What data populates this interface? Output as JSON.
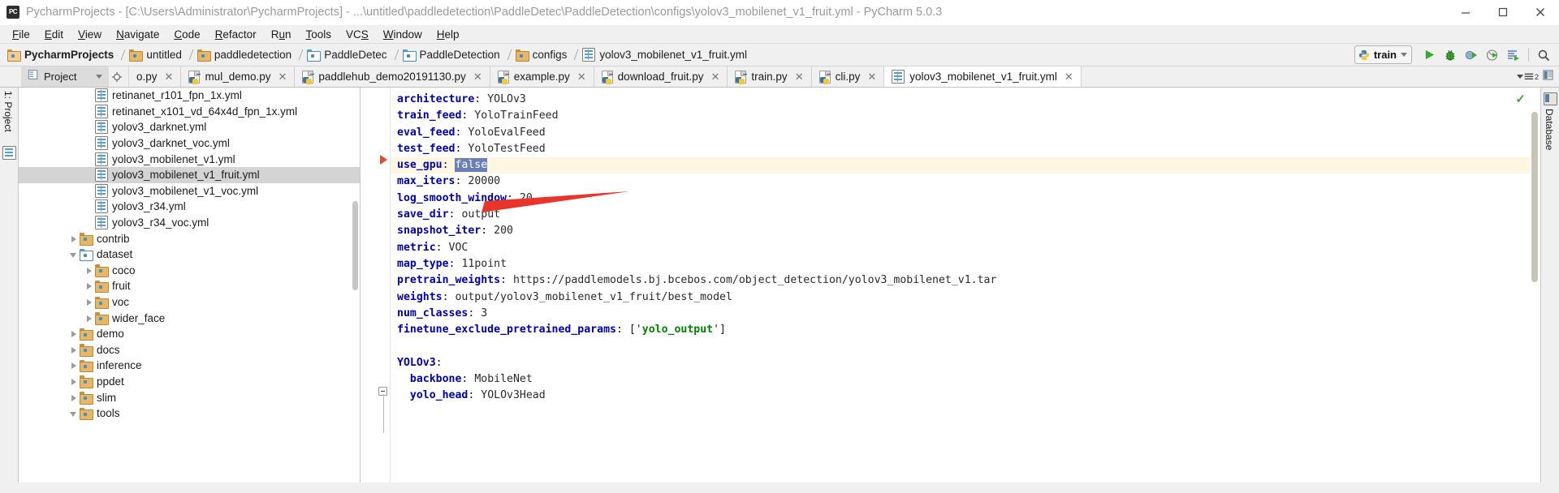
{
  "window": {
    "title": "PycharmProjects - [C:\\Users\\Administrator\\PycharmProjects] - ...\\untitled\\paddledetection\\PaddleDetec\\PaddleDetection\\configs\\yolov3_mobilenet_v1_fruit.yml - PyCharm 5.0.3",
    "app_icon": "pycharm-icon",
    "minimize": "—",
    "maximize": "❑",
    "close": "✕"
  },
  "menu": {
    "items": [
      {
        "label": "File",
        "mnemonic": "F"
      },
      {
        "label": "Edit",
        "mnemonic": "E"
      },
      {
        "label": "View",
        "mnemonic": "V"
      },
      {
        "label": "Navigate",
        "mnemonic": "N"
      },
      {
        "label": "Code",
        "mnemonic": "C"
      },
      {
        "label": "Refactor",
        "mnemonic": "R"
      },
      {
        "label": "Run",
        "mnemonic": "u"
      },
      {
        "label": "Tools",
        "mnemonic": "T"
      },
      {
        "label": "VCS",
        "mnemonic": "S"
      },
      {
        "label": "Window",
        "mnemonic": "W"
      },
      {
        "label": "Help",
        "mnemonic": "H"
      }
    ]
  },
  "breadcrumb": {
    "items": [
      {
        "label": "PycharmProjects",
        "icon": "folder-icon",
        "kind": "folder-open"
      },
      {
        "label": "untitled",
        "icon": "folder-icon",
        "kind": "folder"
      },
      {
        "label": "paddledetection",
        "icon": "folder-icon",
        "kind": "folder"
      },
      {
        "label": "PaddleDetec",
        "icon": "folder-icon",
        "kind": "folder-blue"
      },
      {
        "label": "PaddleDetection",
        "icon": "folder-icon",
        "kind": "folder-blue"
      },
      {
        "label": "configs",
        "icon": "folder-icon",
        "kind": "folder"
      },
      {
        "label": "yolov3_mobilenet_v1_fruit.yml",
        "icon": "yaml-file-icon",
        "kind": "yml"
      }
    ]
  },
  "toolbar": {
    "run_config": "train",
    "run_config_icon": "python-icon",
    "buttons": [
      {
        "name": "run-button",
        "icon": "play-icon"
      },
      {
        "name": "debug-button",
        "icon": "bug-icon"
      },
      {
        "name": "coverage-button",
        "icon": "coverage-icon"
      },
      {
        "name": "profile-button",
        "icon": "profile-icon"
      },
      {
        "name": "run-with-console-button",
        "icon": "console-run-icon"
      },
      {
        "name": "search-everywhere-button",
        "icon": "search-icon"
      }
    ]
  },
  "project_panel": {
    "title": "Project",
    "dropdown_icon": "chevron-down-icon",
    "tool_icons": [
      "locate-icon",
      "collapse-all-icon",
      "settings-icon",
      "hide-icon"
    ],
    "vertical_label": "1: Project",
    "tree": [
      {
        "label": "retinanet_r101_fpn_1x.yml",
        "indent": 4,
        "type": "yml",
        "arrow": "none"
      },
      {
        "label": "retinanet_x101_vd_64x4d_fpn_1x.yml",
        "indent": 4,
        "type": "yml",
        "arrow": "none"
      },
      {
        "label": "yolov3_darknet.yml",
        "indent": 4,
        "type": "yml",
        "arrow": "none"
      },
      {
        "label": "yolov3_darknet_voc.yml",
        "indent": 4,
        "type": "yml",
        "arrow": "none"
      },
      {
        "label": "yolov3_mobilenet_v1.yml",
        "indent": 4,
        "type": "yml",
        "arrow": "none"
      },
      {
        "label": "yolov3_mobilenet_v1_fruit.yml",
        "indent": 4,
        "type": "yml",
        "arrow": "none",
        "selected": true
      },
      {
        "label": "yolov3_mobilenet_v1_voc.yml",
        "indent": 4,
        "type": "yml",
        "arrow": "none"
      },
      {
        "label": "yolov3_r34.yml",
        "indent": 4,
        "type": "yml",
        "arrow": "none"
      },
      {
        "label": "yolov3_r34_voc.yml",
        "indent": 4,
        "type": "yml",
        "arrow": "none"
      },
      {
        "label": "contrib",
        "indent": 3,
        "type": "folder",
        "arrow": "right"
      },
      {
        "label": "dataset",
        "indent": 3,
        "type": "folder-blue",
        "arrow": "down"
      },
      {
        "label": "coco",
        "indent": 4,
        "type": "folder",
        "arrow": "right"
      },
      {
        "label": "fruit",
        "indent": 4,
        "type": "folder",
        "arrow": "right"
      },
      {
        "label": "voc",
        "indent": 4,
        "type": "folder",
        "arrow": "right"
      },
      {
        "label": "wider_face",
        "indent": 4,
        "type": "folder",
        "arrow": "right"
      },
      {
        "label": "demo",
        "indent": 3,
        "type": "folder",
        "arrow": "right"
      },
      {
        "label": "docs",
        "indent": 3,
        "type": "folder",
        "arrow": "right"
      },
      {
        "label": "inference",
        "indent": 3,
        "type": "folder",
        "arrow": "right"
      },
      {
        "label": "ppdet",
        "indent": 3,
        "type": "folder",
        "arrow": "right"
      },
      {
        "label": "slim",
        "indent": 3,
        "type": "folder",
        "arrow": "right"
      },
      {
        "label": "tools",
        "indent": 3,
        "type": "folder",
        "arrow": "down"
      }
    ]
  },
  "editor_tabs": {
    "items": [
      {
        "label": "o.py",
        "icon": "python-file-icon",
        "active": false,
        "clipped": true
      },
      {
        "label": "mul_demo.py",
        "icon": "python-file-icon",
        "active": false
      },
      {
        "label": "paddlehub_demo20191130.py",
        "icon": "python-file-icon",
        "active": false
      },
      {
        "label": "example.py",
        "icon": "python-file-icon",
        "active": false
      },
      {
        "label": "download_fruit.py",
        "icon": "python-file-icon",
        "active": false
      },
      {
        "label": "train.py",
        "icon": "python-file-icon",
        "active": false
      },
      {
        "label": "cli.py",
        "icon": "python-file-icon",
        "active": false
      },
      {
        "label": "yolov3_mobilenet_v1_fruit.yml",
        "icon": "yaml-file-icon",
        "active": true
      }
    ],
    "close_glyph": "✕",
    "overflow_label": "2",
    "overflow_icon": "tab-list-icon",
    "extra_icon": "database-panel-icon"
  },
  "editor": {
    "status_icon": "inspection-ok-check",
    "lines": [
      {
        "indent": 0,
        "key": "architecture",
        "value": "YOLOv3",
        "highlight": false
      },
      {
        "indent": 0,
        "key": "train_feed",
        "value": "YoloTrainFeed",
        "highlight": false
      },
      {
        "indent": 0,
        "key": "eval_feed",
        "value": "YoloEvalFeed",
        "highlight": false
      },
      {
        "indent": 0,
        "key": "test_feed",
        "value": "YoloTestFeed",
        "highlight": false
      },
      {
        "indent": 0,
        "key": "use_gpu",
        "value": "false",
        "highlight": true,
        "selected_value": true
      },
      {
        "indent": 0,
        "key": "max_iters",
        "value": "20000",
        "highlight": false
      },
      {
        "indent": 0,
        "key": "log_smooth_window",
        "value": "20",
        "highlight": false
      },
      {
        "indent": 0,
        "key": "save_dir",
        "value": "output",
        "highlight": false
      },
      {
        "indent": 0,
        "key": "snapshot_iter",
        "value": "200",
        "highlight": false
      },
      {
        "indent": 0,
        "key": "metric",
        "value": "VOC",
        "highlight": false
      },
      {
        "indent": 0,
        "key": "map_type",
        "value": "11point",
        "highlight": false
      },
      {
        "indent": 0,
        "key": "pretrain_weights",
        "value": "https://paddlemodels.bj.bcebos.com/object_detection/yolov3_mobilenet_v1.tar",
        "highlight": false
      },
      {
        "indent": 0,
        "key": "weights",
        "value": "output/yolov3_mobilenet_v1_fruit/best_model",
        "highlight": false
      },
      {
        "indent": 0,
        "key": "num_classes",
        "value": "3",
        "highlight": false
      },
      {
        "indent": 0,
        "key": "finetune_exclude_pretrained_params",
        "value": "['yolo_output']",
        "highlight": false,
        "is_list": true,
        "list_items": [
          "yolo_output"
        ]
      },
      {
        "indent": 0,
        "key": "",
        "value": "",
        "highlight": false,
        "blank": true
      },
      {
        "indent": 0,
        "key": "YOLOv3",
        "value": "",
        "highlight": false,
        "fold": true
      },
      {
        "indent": 1,
        "key": "backbone",
        "value": "MobileNet",
        "highlight": false
      },
      {
        "indent": 1,
        "key": "yolo_head",
        "value": "YOLOv3Head",
        "highlight": false
      }
    ]
  },
  "right_panel": {
    "label": "Database",
    "icon": "database-icon"
  },
  "annotation": {
    "arrow_color": "#e8342a",
    "points_to": "yolov3_mobilenet_v1_fruit.yml"
  }
}
